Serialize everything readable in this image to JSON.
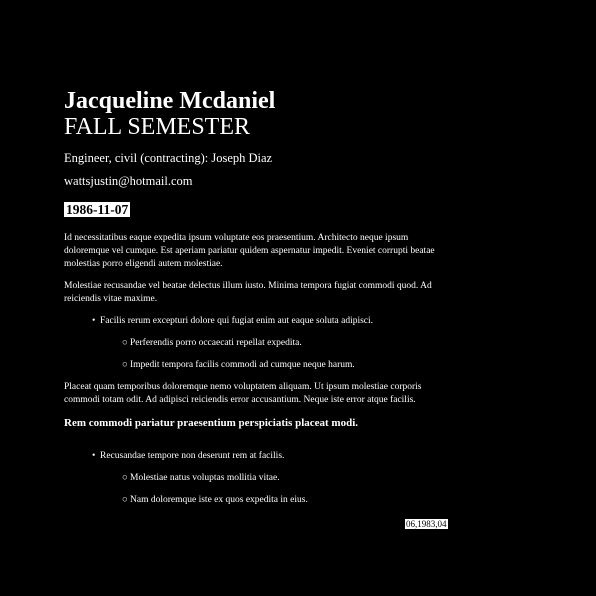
{
  "header": {
    "name": "Jacqueline Mcdaniel",
    "semester": "FALL SEMESTER",
    "role": "Engineer, civil (contracting): Joseph Diaz",
    "email": "wattsjustin@hotmail.com",
    "date": "1986-11-07"
  },
  "body": {
    "para1": "Id necessitatibus eaque expedita ipsum voluptate eos praesentium. Architecto neque ipsum doloremque vel cumque. Est aperiam pariatur quidem aspernatur impedit. Eveniet corrupti beatae molestias porro eligendi autem molestiae.",
    "para2": "Molestiae recusandae vel beatae delectus illum iusto. Minima tempora fugiat commodi quod. Ad reiciendis vitae maxime.",
    "list1": {
      "item": "Facilis rerum excepturi dolore qui fugiat enim aut eaque soluta adipisci.",
      "sub": [
        "Perferendis porro occaecati repellat expedita.",
        "Impedit tempora facilis commodi ad cumque neque harum."
      ]
    },
    "para3": "Placeat quam temporibus doloremque nemo voluptatem aliquam. Ut ipsum molestiae corporis commodi totam odit. Ad adipisci reiciendis error accusantium. Neque iste error atque facilis.",
    "subheading": "Rem commodi pariatur praesentium perspiciatis placeat modi.",
    "list2": {
      "item": "Recusandae tempore non deserunt rem at facilis.",
      "sub": [
        "Molestiae natus voluptas mollitia vitae.",
        "Nam doloremque iste ex quos expedita in eius."
      ]
    }
  },
  "footer": {
    "code": "06,1983,04"
  }
}
